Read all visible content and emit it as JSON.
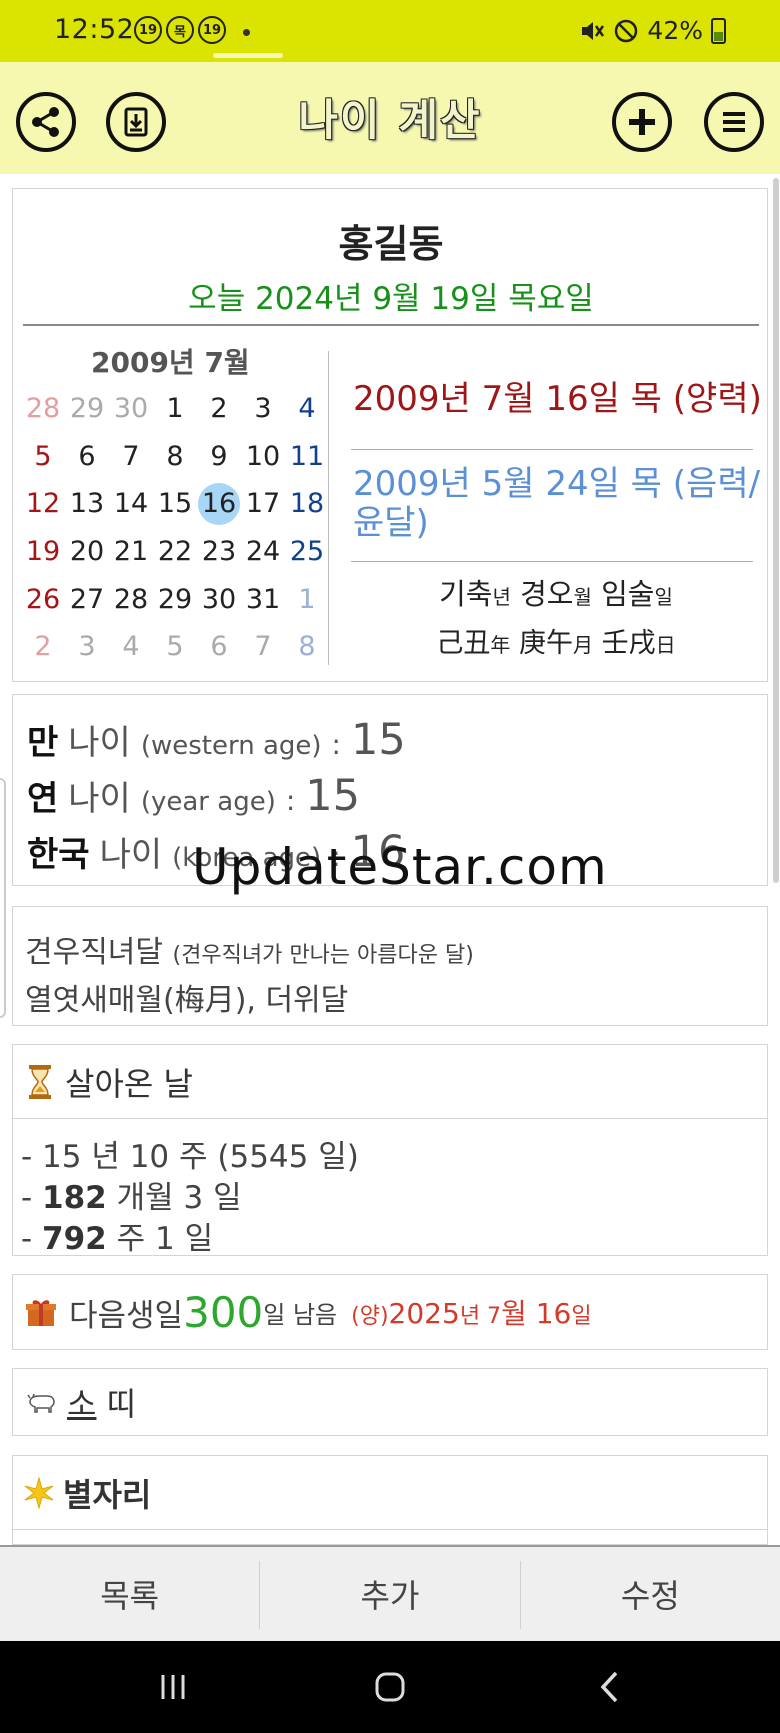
{
  "status": {
    "time": "12:52",
    "notifications": [
      "19",
      "목",
      "19"
    ],
    "battery": "42%"
  },
  "appbar": {
    "title": "나이 계산",
    "icons": [
      "share-icon",
      "download-icon",
      "add-icon",
      "menu-icon"
    ]
  },
  "profile": {
    "name": "홍길동",
    "today": "오늘 2024년 9월 19일 목요일"
  },
  "calendar": {
    "title": "2009년 7월",
    "weeks": [
      [
        "28",
        "29",
        "30",
        "1",
        "2",
        "3",
        "4"
      ],
      [
        "5",
        "6",
        "7",
        "8",
        "9",
        "10",
        "11"
      ],
      [
        "12",
        "13",
        "14",
        "15",
        "16",
        "17",
        "18"
      ],
      [
        "19",
        "20",
        "21",
        "22",
        "23",
        "24",
        "25"
      ],
      [
        "26",
        "27",
        "28",
        "29",
        "30",
        "31",
        "1"
      ],
      [
        "2",
        "3",
        "4",
        "5",
        "6",
        "7",
        "8"
      ]
    ],
    "selected": "16",
    "colors": {
      "sunday": "#a51515",
      "saturday": "#12418c",
      "selected_bg": "#a8d6f7"
    }
  },
  "birth": {
    "solar": "2009년 7월 16일 목 (양력)",
    "lunar": "2009년 5월 24일 목 (음력/윤달)",
    "ganji_ko": [
      {
        "a": "기축",
        "b": "년"
      },
      {
        "a": "경오",
        "b": "월"
      },
      {
        "a": "임술",
        "b": "일"
      }
    ],
    "ganji_cn": [
      {
        "a": "己丑",
        "b": "年"
      },
      {
        "a": "庚午",
        "b": "月"
      },
      {
        "a": "壬戌",
        "b": "日"
      }
    ]
  },
  "ages": [
    {
      "k": "만",
      "k2": "나이",
      "en": "(western age)",
      "colon": ":",
      "v": "15"
    },
    {
      "k": "연",
      "k2": "나이",
      "en": "(year age)",
      "colon": ":",
      "v": "15"
    },
    {
      "k": "한국",
      "k2": "나이",
      "en": "(korea age)",
      "colon": ":",
      "v": "16"
    }
  ],
  "watermark": "UpdateStar.com",
  "moon": {
    "name": "견우직녀달",
    "desc": "(견우직녀가 만나는 아름다운 달)",
    "line2": "열엿새매월(梅月), 더위달"
  },
  "lived": {
    "title": "살아온 날",
    "icon": "hourglass-icon",
    "lines": [
      {
        "a": "- 15 년 10 주 (5545 일)"
      },
      {
        "b": "182",
        "a": "- ",
        "c": " 개월 3 일"
      },
      {
        "b": "792",
        "a": "- ",
        "c": " 주 1 일"
      }
    ]
  },
  "birthday": {
    "icon": "gift-icon",
    "label": "다음생일 ",
    "days": "300",
    "suffix": "일 남음",
    "date_prefix": "(양)",
    "date_y": "2025",
    "date_rest1": "년 7",
    "date_rest2": "월 16",
    "date_rest3": "일"
  },
  "zodiac": {
    "icon": "ox-icon",
    "label": "소",
    "label2": " 띠"
  },
  "constellation": {
    "icon": "sparkle-icon",
    "title": "별자리"
  },
  "bottom_tabs": [
    "목록",
    "추가",
    "수정"
  ]
}
